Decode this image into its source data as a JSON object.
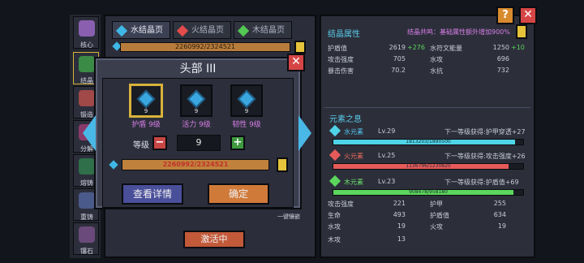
{
  "sidebar": {
    "items": [
      {
        "label": "核心",
        "icon": "core-icon"
      },
      {
        "label": "结晶",
        "icon": "crystal-icon"
      },
      {
        "label": "锻造",
        "icon": "forge-icon"
      },
      {
        "label": "分解",
        "icon": "decompose-icon"
      },
      {
        "label": "熔铸",
        "icon": "cast-icon"
      },
      {
        "label": "重铸",
        "icon": "reforge-icon"
      },
      {
        "label": "镶石",
        "icon": "inlay-icon"
      }
    ]
  },
  "tabs": [
    {
      "label": "水结晶页",
      "color": "#3fb7e6"
    },
    {
      "label": "火结晶页",
      "color": "#e24c4c"
    },
    {
      "label": "木结晶页",
      "color": "#53c853"
    }
  ],
  "back_exp": "2260992/2324521",
  "modal": {
    "title": "头部 III",
    "slots": [
      {
        "label": "护盾 9级",
        "level": "9"
      },
      {
        "label": "活力 9级",
        "level": "9"
      },
      {
        "label": "韧性 9级",
        "level": "9"
      }
    ],
    "level_label": "等级",
    "level_value": "9",
    "minus": "−",
    "plus": "+",
    "exp_text": "2260992/2324521",
    "exp_fill": 0.97,
    "detail_button": "查看详情",
    "confirm_button": "确定",
    "close": "✕"
  },
  "activate_button": "激活中",
  "oneclick_label": "一键镶嵌",
  "right": {
    "help": "?",
    "close": "✕",
    "crystal_title": "结晶属性",
    "resonance": "结晶共鸣：基础属性额外增加900%",
    "stats": [
      {
        "name": "护盾值",
        "value": "2619",
        "inc": "+276",
        "name2": "水符文能量",
        "value2": "1250",
        "inc2": "+10"
      },
      {
        "name": "攻击强度",
        "value": "705",
        "inc": "",
        "name2": "水攻",
        "value2": "696",
        "inc2": ""
      },
      {
        "name": "暴击伤害",
        "value": "70.2",
        "inc": "",
        "name2": "水抗",
        "value2": "732",
        "inc2": ""
      }
    ],
    "element_title": "元素之息",
    "elements": [
      {
        "name": "水元素",
        "level": "Lv.29",
        "next": "下一等级获得:护甲穿透+27",
        "exp": "1813203/1890500",
        "fill": 0.959,
        "color": "#4fd3e6",
        "text_color": "#56c6ee"
      },
      {
        "name": "火元素",
        "level": "Lv.25",
        "next": "下一等级获得:攻击强度+26",
        "exp": "1136796/1230820",
        "fill": 0.924,
        "color": "#e65a5a",
        "text_color": "#ee6b5a"
      },
      {
        "name": "木元素",
        "level": "Lv.23",
        "next": "下一等级获得:护盾值+69",
        "exp": "908478/958180",
        "fill": 0.948,
        "color": "#5cd65c",
        "text_color": "#6be06b"
      }
    ],
    "bottom_stats": [
      {
        "name": "攻击强度",
        "value": "221",
        "name2": "护甲",
        "value2": "255"
      },
      {
        "name": "生命",
        "value": "493",
        "name2": "护盾值",
        "value2": "634"
      },
      {
        "name": "水攻",
        "value": "19",
        "name2": "火攻",
        "value2": "19"
      },
      {
        "name": "木攻",
        "value": "13",
        "name2": "",
        "value2": ""
      }
    ]
  }
}
